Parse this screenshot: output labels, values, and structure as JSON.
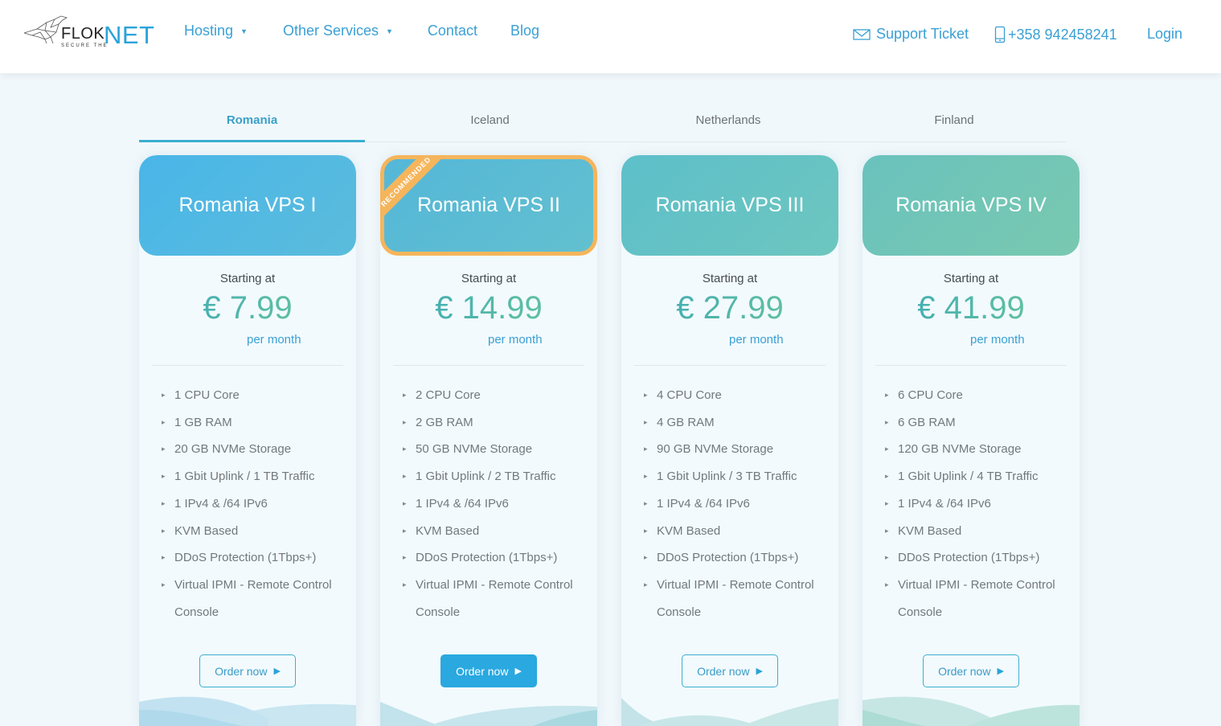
{
  "header": {
    "logo": {
      "brand_left": "FLOKI",
      "brand_right": "NET",
      "tagline": "SECURE THE"
    },
    "nav": [
      {
        "label": "Hosting",
        "has_dropdown": true
      },
      {
        "label": "Other Services",
        "has_dropdown": true
      },
      {
        "label": "Contact",
        "has_dropdown": false
      },
      {
        "label": "Blog",
        "has_dropdown": false
      }
    ],
    "support_ticket": "Support Ticket",
    "phone": "+358 942458241",
    "login": "Login"
  },
  "tabs": [
    {
      "label": "Romania",
      "active": true
    },
    {
      "label": "Iceland",
      "active": false
    },
    {
      "label": "Netherlands",
      "active": false
    },
    {
      "label": "Finland",
      "active": false
    }
  ],
  "plans": [
    {
      "name": "Romania VPS I",
      "recommended": false,
      "starting_label": "Starting at",
      "price": "€ 7.99",
      "period": "per month",
      "features": [
        "1 CPU Core",
        "1 GB RAM",
        "20 GB NVMe Storage",
        "1 Gbit Uplink / 1 TB Traffic",
        "1 IPv4 & /64 IPv6",
        "KVM Based",
        "DDoS Protection (1Tbps+)",
        "Virtual IPMI - Remote Control Console"
      ],
      "order_label": "Order now",
      "colors": {
        "from": "#4ab8e6",
        "to": "#5bbcdc"
      }
    },
    {
      "name": "Romania VPS II",
      "recommended": true,
      "ribbon_label": "RECOMMENDED",
      "starting_label": "Starting at",
      "price": "€ 14.99",
      "period": "per month",
      "features": [
        "2 CPU Core",
        "2 GB RAM",
        "50 GB NVMe Storage",
        "1 Gbit Uplink / 2 TB Traffic",
        "1 IPv4 & /64 IPv6",
        "KVM Based",
        "DDoS Protection (1Tbps+)",
        "Virtual IPMI - Remote Control Console"
      ],
      "order_label": "Order now",
      "colors": {
        "from": "#56b8d6",
        "to": "#60bfd0"
      }
    },
    {
      "name": "Romania VPS III",
      "recommended": false,
      "starting_label": "Starting at",
      "price": "€ 27.99",
      "period": "per month",
      "features": [
        "4 CPU Core",
        "4 GB RAM",
        "90 GB NVMe Storage",
        "1 Gbit Uplink / 3 TB Traffic",
        "1 IPv4 & /64 IPv6",
        "KVM Based",
        "DDoS Protection (1Tbps+)",
        "Virtual IPMI - Remote Control Console"
      ],
      "order_label": "Order now",
      "colors": {
        "from": "#5fc0c8",
        "to": "#6cc6c0"
      }
    },
    {
      "name": "Romania VPS IV",
      "recommended": false,
      "starting_label": "Starting at",
      "price": "€ 41.99",
      "period": "per month",
      "features": [
        "6 CPU Core",
        "6 GB RAM",
        "120 GB NVMe Storage",
        "1 Gbit Uplink / 4 TB Traffic",
        "1 IPv4 & /64 IPv6",
        "KVM Based",
        "DDoS Protection (1Tbps+)",
        "Virtual IPMI - Remote Control Console"
      ],
      "order_label": "Order now",
      "colors": {
        "from": "#6cc3bc",
        "to": "#78c8b0"
      }
    }
  ],
  "colors": {
    "accent": "#3aa0d4",
    "ribbon": "#f5b55b",
    "button_primary": "#2aa8e0"
  }
}
